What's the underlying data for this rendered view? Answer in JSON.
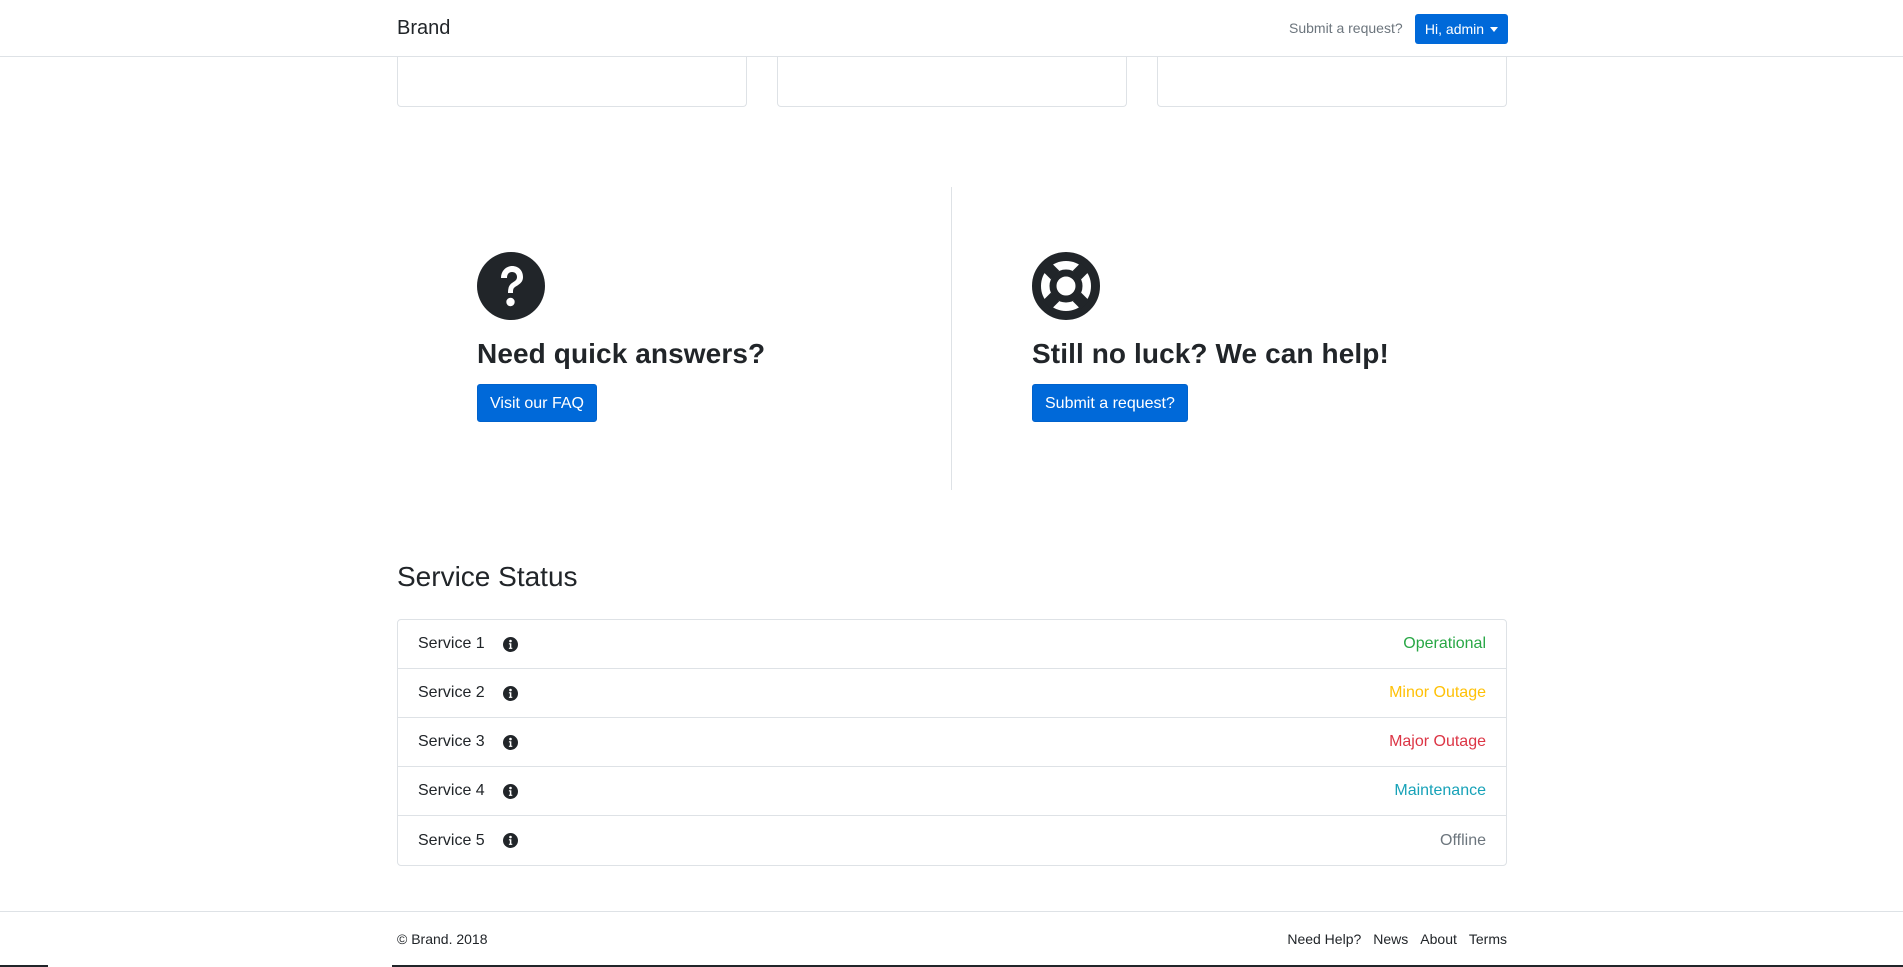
{
  "navbar": {
    "brand": "Brand",
    "submit_link": "Submit a request?",
    "user_menu": "Hi, admin"
  },
  "help": {
    "faq": {
      "icon": "question-circle-icon",
      "title": "Need quick answers?",
      "button": "Visit our FAQ"
    },
    "support": {
      "icon": "life-ring-icon",
      "title": "Still no luck? We can help!",
      "button": "Submit a request?"
    }
  },
  "service_status": {
    "title": "Service Status",
    "services": [
      {
        "name": "Service 1",
        "status": "Operational",
        "color": "#28a745"
      },
      {
        "name": "Service 2",
        "status": "Minor Outage",
        "color": "#ffc107"
      },
      {
        "name": "Service 3",
        "status": "Major Outage",
        "color": "#dc3545"
      },
      {
        "name": "Service 4",
        "status": "Maintenance",
        "color": "#17a2b8"
      },
      {
        "name": "Service 5",
        "status": "Offline",
        "color": "#6c757d"
      }
    ]
  },
  "footer": {
    "copyright": "© Brand. 2018",
    "links": [
      "Need Help?",
      "News",
      "About",
      "Terms"
    ]
  },
  "colors": {
    "primary": "#0069d9",
    "border": "#dee2e6",
    "text": "#212529"
  }
}
